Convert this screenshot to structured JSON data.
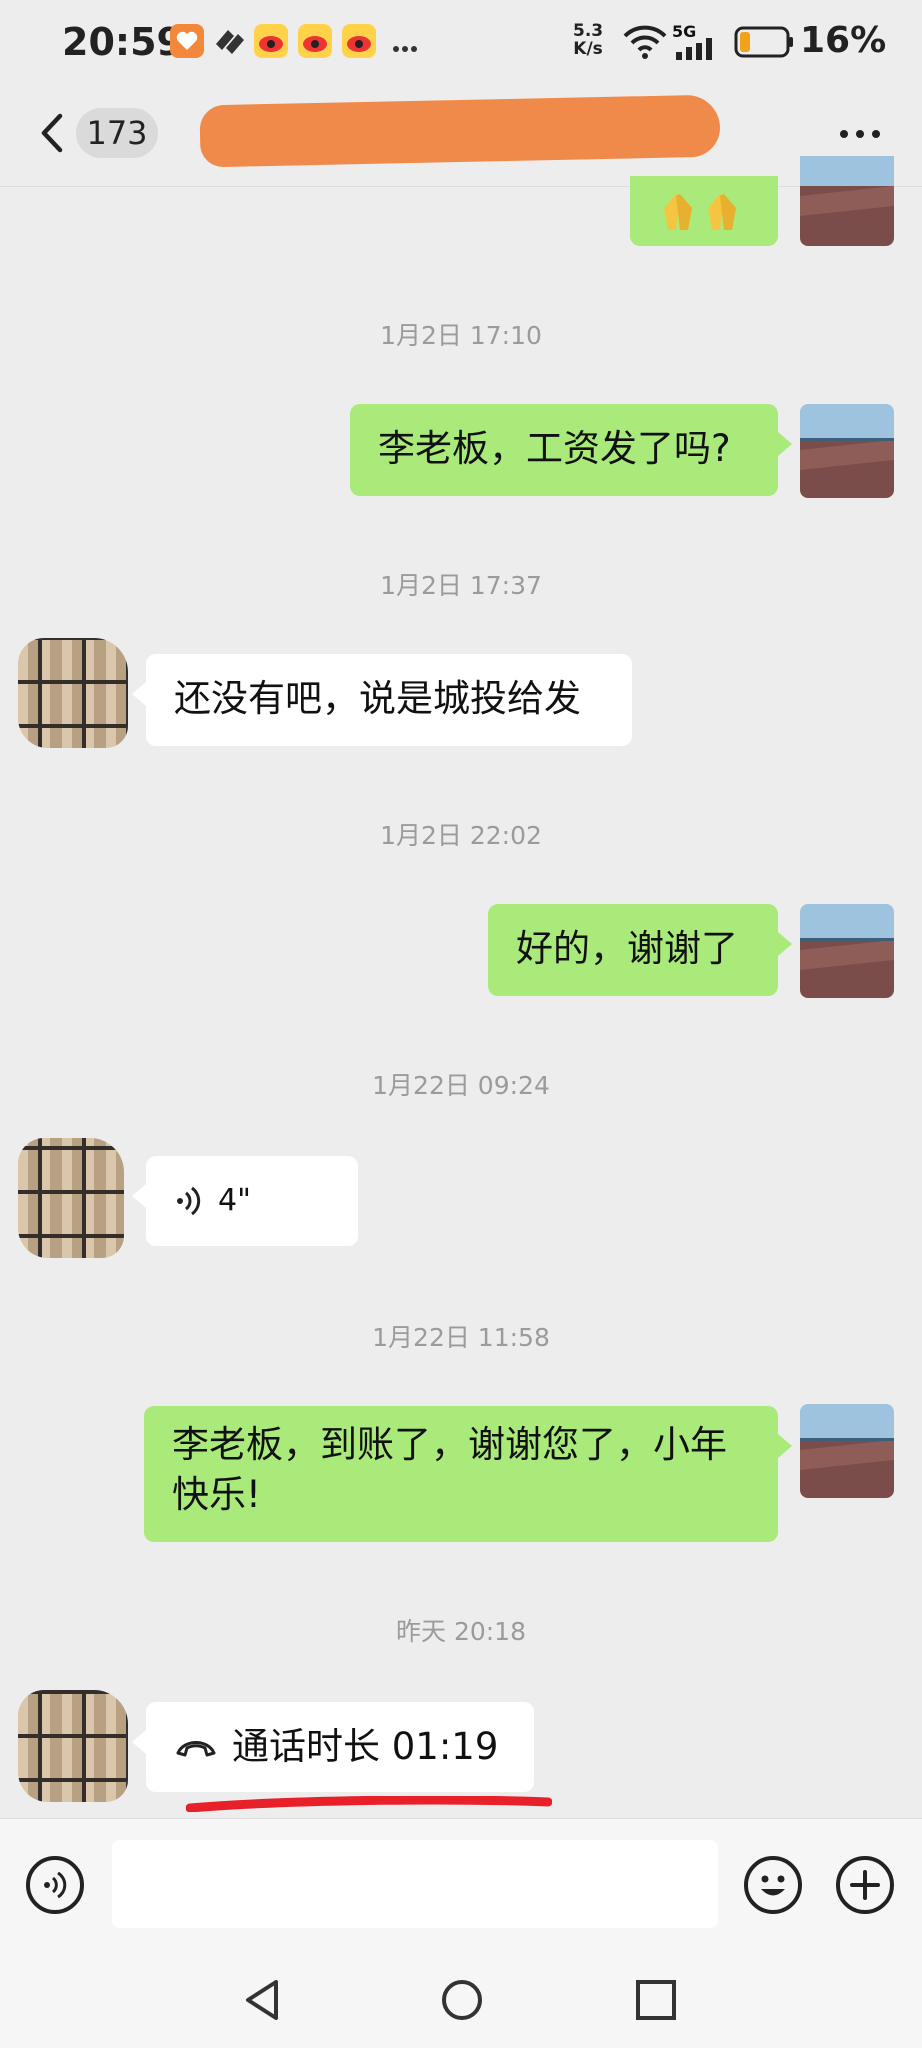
{
  "status_bar": {
    "time": "20:59",
    "net_speed_value": "5.3",
    "net_speed_unit": "K/s",
    "network": "5G",
    "battery": "16%",
    "icons": [
      "app-heart-icon",
      "app-swirl-icon",
      "weibo-icon",
      "weibo-icon",
      "weibo-icon",
      "more-dots-icon",
      "wifi-icon",
      "signal-icon",
      "battery-icon"
    ]
  },
  "header": {
    "unread_count": "173"
  },
  "messages": [
    {
      "timestamp": "1月2日 17:10",
      "from": "self",
      "text": "李老板，工资发了吗?"
    },
    {
      "timestamp": "1月2日 17:37",
      "from": "other",
      "text": "还没有吧，说是城投给发"
    },
    {
      "timestamp": "1月2日 22:02",
      "from": "self",
      "text": "好的，谢谢了"
    },
    {
      "timestamp": "1月22日 09:24",
      "from": "other",
      "type": "voice",
      "duration": "4\""
    },
    {
      "timestamp": "1月22日 11:58",
      "from": "self",
      "text_line1": "李老板，到账了，谢谢您了，小年",
      "text_line2": "快乐!"
    },
    {
      "timestamp": "昨天 20:18",
      "from": "other",
      "type": "call",
      "text": "通话时长 01:19"
    }
  ],
  "colors": {
    "bubble_self": "#a9ea7a",
    "bubble_other": "#ffffff",
    "background": "#ededed",
    "redaction": "#f08a4b",
    "annotation_underline": "#e8202a"
  }
}
